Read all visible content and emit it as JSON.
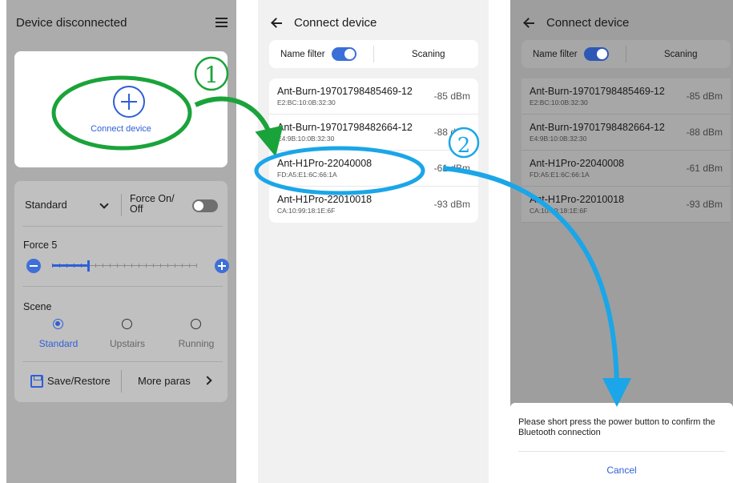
{
  "panel1": {
    "status_title": "Device disconnected",
    "connect_label": "Connect device",
    "mode": {
      "selected": "Standard"
    },
    "force_toggle": {
      "label": "Force On/ Off",
      "on": false
    },
    "force": {
      "label": "Force 5",
      "level_fraction": 0.25
    },
    "scene": {
      "label": "Scene",
      "options": [
        {
          "label": "Standard",
          "selected": true
        },
        {
          "label": "Upstairs",
          "selected": false
        },
        {
          "label": "Running",
          "selected": false
        }
      ]
    },
    "actions": {
      "save_label": "Save/Restore",
      "more_label": "More paras"
    }
  },
  "panel2": {
    "title": "Connect device",
    "name_filter_label": "Name filter",
    "name_filter_on": true,
    "scan_label": "Scaning",
    "devices": [
      {
        "name": "Ant-Burn-19701798485469-12",
        "mac": "E2:BC:10:0B:32:30",
        "rssi": "-85 dBm"
      },
      {
        "name": "Ant-Burn-19701798482664-12",
        "mac": "E4:9B:10:0B:32:30",
        "rssi": "-88 dBm"
      },
      {
        "name": "Ant-H1Pro-22040008",
        "mac": "FD:A5:E1:6C:66:1A",
        "rssi": "-61 dBm"
      },
      {
        "name": "Ant-H1Pro-22010018",
        "mac": "CA:10:99:18:1E:6F",
        "rssi": "-93 dBm"
      }
    ]
  },
  "panel3": {
    "title": "Connect device",
    "name_filter_label": "Name filter",
    "scan_label": "Scaning",
    "devices": [
      {
        "name": "Ant-Burn-19701798485469-12",
        "mac": "E2:BC:10:0B:32:30",
        "rssi": "-85 dBm"
      },
      {
        "name": "Ant-Burn-19701798482664-12",
        "mac": "E4:9B:10:0B:32:30",
        "rssi": "-88 dBm"
      },
      {
        "name": "Ant-H1Pro-22040008",
        "mac": "FD:A5:E1:6C:66:1A",
        "rssi": "-61 dBm"
      },
      {
        "name": "Ant-H1Pro-22010018",
        "mac": "CA:10:99:18:1E:6F",
        "rssi": "-93 dBm"
      }
    ],
    "dialog": {
      "message": "Please short press the power button to confirm the Bluetooth connection",
      "cancel_label": "Cancel"
    }
  },
  "annotations": {
    "step1": "1",
    "step2": "2",
    "step1_color": "#1aa33a",
    "step2_color": "#1aa6e8"
  }
}
